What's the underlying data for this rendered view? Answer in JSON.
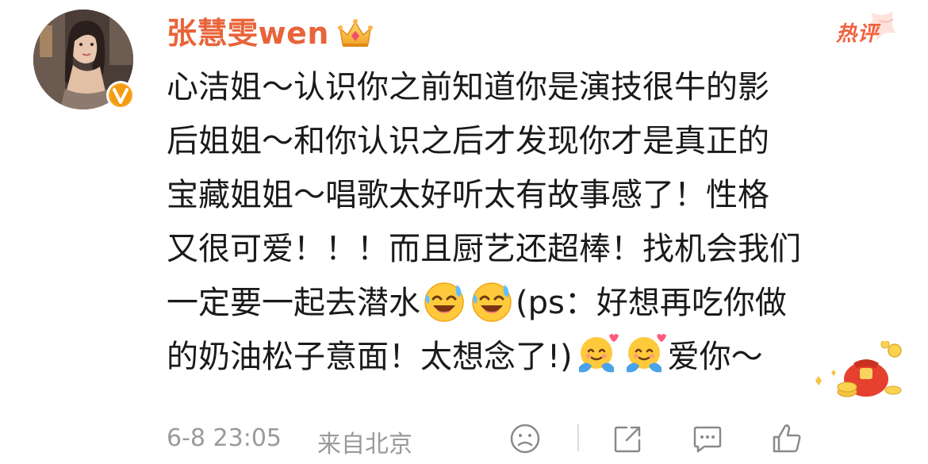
{
  "user": {
    "name": "张慧雯wen",
    "verified": true,
    "crown_icon": "crown-icon"
  },
  "badge": {
    "label": "热评",
    "color": "#f2603d"
  },
  "comment": {
    "lines": [
      [
        "心洁姐～认识你之前知道你是演技很牛的影"
      ],
      [
        "后姐姐～和你认识之后才发现你才是真正的"
      ],
      [
        "宝藏姐姐～唱歌太好听太有故事感了！性格"
      ],
      [
        "又很可爱！！！而且厨艺还超棒！找机会我们"
      ],
      [
        "一定要一起去潜水"
      ],
      [
        "的奶油松子意面！太想念了!)"
      ]
    ],
    "line5_tail": "(ps：好想再吃你做",
    "line6_tail": "爱你～",
    "emoji_laugh_cry": "laugh-cry-emoji",
    "emoji_hug": "hug-emoji"
  },
  "footer": {
    "time": "6-8 23:05",
    "location": "来自北京"
  },
  "colors": {
    "name": "#e8643a",
    "text": "#1a1a1a",
    "meta": "#9a9a9a"
  }
}
